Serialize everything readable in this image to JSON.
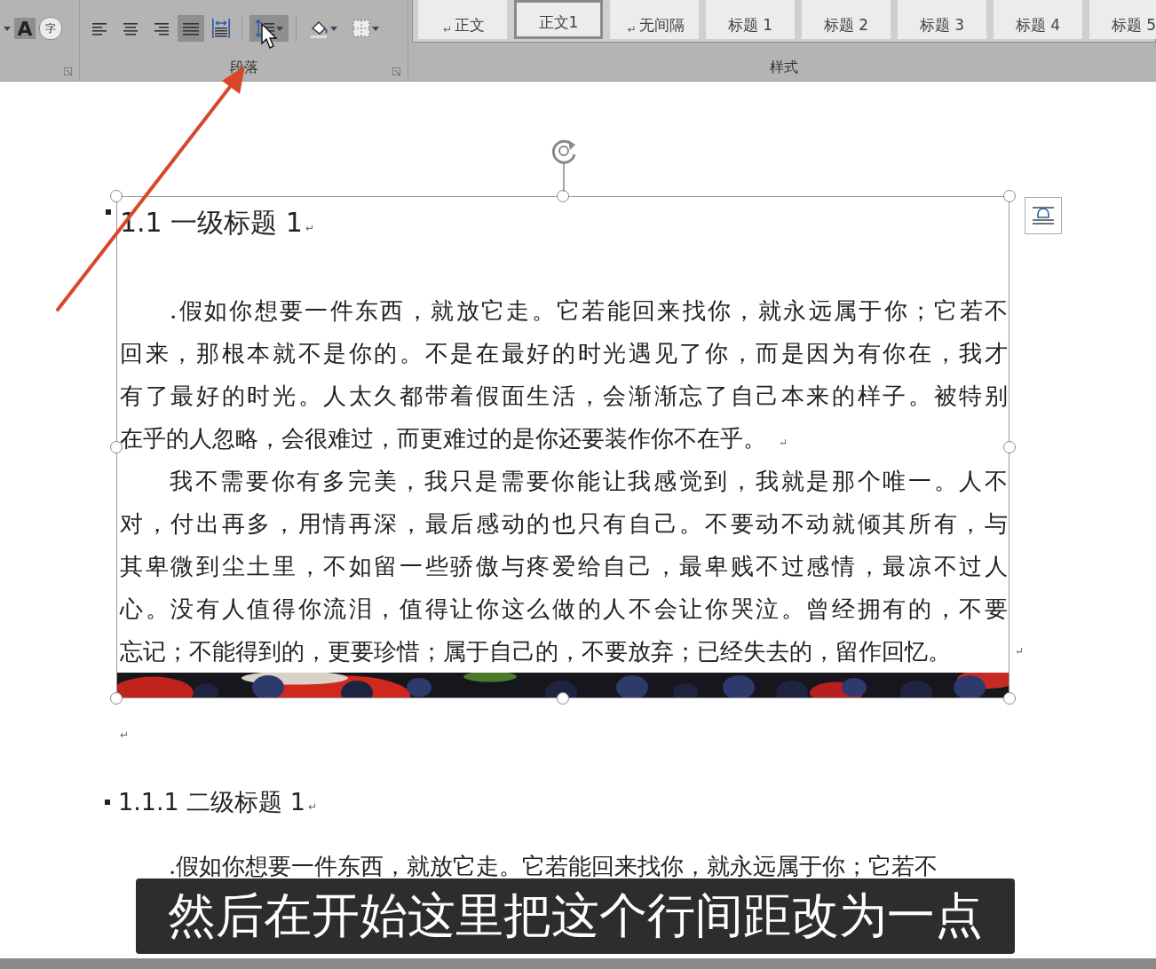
{
  "ribbon": {
    "font_group": {
      "glyphs": [
        "A",
        "字"
      ]
    },
    "paragraph_group": {
      "label": "段落",
      "buttons": [
        {
          "kind": "align-left",
          "selected": false
        },
        {
          "kind": "align-center",
          "selected": false
        },
        {
          "kind": "align-right",
          "selected": false
        },
        {
          "kind": "justify",
          "selected": true
        },
        {
          "kind": "distribute",
          "selected": false
        },
        {
          "kind": "line-spacing",
          "selected": true
        },
        {
          "kind": "shading",
          "selected": false
        },
        {
          "kind": "borders",
          "selected": false
        }
      ]
    },
    "styles_group": {
      "label": "样式",
      "styles": [
        {
          "label": "正文",
          "mark": "↵",
          "selected": false
        },
        {
          "label": "正文1",
          "selected": true
        },
        {
          "label": "无间隔",
          "mark": "↵",
          "selected": false
        },
        {
          "label": "标题 1",
          "selected": false
        },
        {
          "label": "标题 2",
          "selected": false
        },
        {
          "label": "标题 3",
          "selected": false
        },
        {
          "label": "标题 4",
          "selected": false
        },
        {
          "label": "标题 5",
          "selected": false
        }
      ]
    }
  },
  "document": {
    "text_box": {
      "heading": {
        "text": "1.1 一级标题 1",
        "mark": "↵"
      },
      "paragraphs": [
        {
          "lines": [
            ".假如你想要一件东西，就放它走。它若能回来找你，就永远属于你；它若不",
            "回来，那根本就不是你的。不是在最好的时光遇见了你，而是因为有你在，我才",
            "有了最好的时光。人太久都带着假面生活，会渐渐忘了自己本来的样子。被特别",
            "在乎的人忽略，会很难过，而更难过的是你还要装作你不在乎。"
          ],
          "mark": "↵"
        },
        {
          "lines": [
            "我不需要你有多完美，我只是需要你能让我感觉到，我就是那个唯一。人不",
            "对，付出再多，用情再深，最后感动的也只有自己。不要动不动就倾其所有，与",
            "其卑微到尘土里，不如留一些骄傲与疼爱给自己，最卑贱不过感情，最凉不过人",
            "心。没有人值得你流泪，值得让你这么做的人不会让你哭泣。曾经拥有的，不要",
            "忘记；不能得到的，更要珍惜；属于自己的，不要放弃；已经失去的，留作回忆。"
          ],
          "mark": "↵"
        }
      ]
    },
    "empty_paragraph_mark": "↵",
    "heading_2": {
      "text": "1.1.1 二级标题 1",
      "mark": "↵"
    },
    "paragraph": {
      "lines": [
        ".假如你想要一件东西，就放它走。它若能回来找你，就永远属于你；它若不"
      ]
    }
  },
  "subtitle": "然后在开始这里把这个行间距改为一点"
}
